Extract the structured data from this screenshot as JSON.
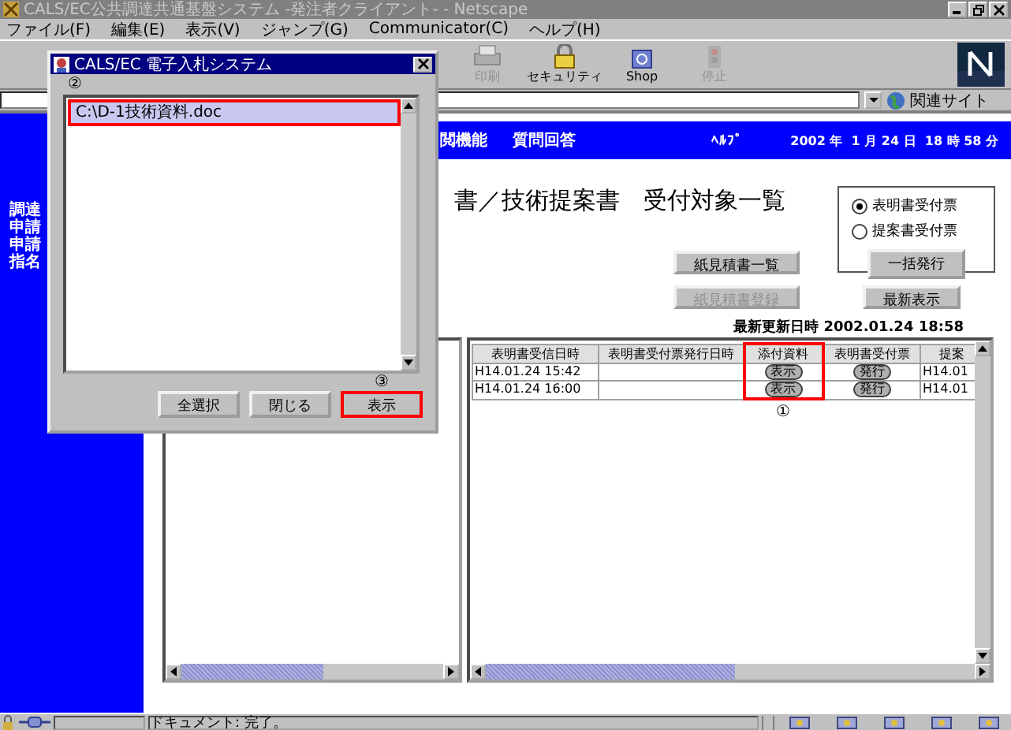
{
  "window": {
    "title": "CALS/EC公共調達共通基盤システム -発注者クライアント- - Netscape"
  },
  "menu": [
    "ファイル(F)",
    "編集(E)",
    "表示(V)",
    "ジャンプ(G)",
    "Communicator(C)",
    "ヘルプ(H)"
  ],
  "toolbar": [
    {
      "label": "印刷",
      "kind": "print",
      "disabled": true
    },
    {
      "label": "セキュリティ",
      "kind": "security",
      "disabled": false
    },
    {
      "label": "Shop",
      "kind": "shop",
      "disabled": false
    },
    {
      "label": "停止",
      "kind": "stop",
      "disabled": true
    }
  ],
  "location_bar": {
    "related_sites": "関連サイト"
  },
  "nav_bar": {
    "items": [
      "閲機能",
      "質問回答"
    ],
    "help": "ﾍﾙﾌﾟ",
    "datetime": "2002 年  1 月 24 日  18 時 58 分"
  },
  "sidebar": {
    "items": [
      "調達",
      "申請",
      "申請",
      "指名"
    ]
  },
  "page": {
    "heading": "書／技術提案書　受付対象一覧",
    "options": [
      {
        "label": "表明書受付票",
        "selected": true
      },
      {
        "label": "提案書受付票",
        "selected": false
      }
    ],
    "batch_button": "一括発行",
    "buttons": [
      {
        "label": "紙見積書一覧",
        "disabled": false
      },
      {
        "label": "紙見積書登録",
        "disabled": true
      },
      {
        "label": "最新表示",
        "disabled": false
      }
    ],
    "last_updated": "最新更新日時 2002.01.24 18:58"
  },
  "table": {
    "columns": [
      {
        "label": "表明書受信日時",
        "highlighted": false
      },
      {
        "label": "表明書受付票発行日時",
        "highlighted": false
      },
      {
        "label": "添付資料",
        "highlighted": true,
        "marker": "①"
      },
      {
        "label": "表明書受付票",
        "highlighted": false
      },
      {
        "label": "提案",
        "highlighted": false
      }
    ],
    "rows": [
      [
        {
          "kind": "text",
          "text": "H14.01.24 15:42"
        },
        {
          "kind": "empty"
        },
        {
          "kind": "button",
          "text": "表示"
        },
        {
          "kind": "button",
          "text": "発行"
        },
        {
          "kind": "text",
          "text": "H14.01"
        }
      ],
      [
        {
          "kind": "text",
          "text": "H14.01.24 16:00"
        },
        {
          "kind": "empty"
        },
        {
          "kind": "button",
          "text": "表示"
        },
        {
          "kind": "button",
          "text": "発行"
        },
        {
          "kind": "text",
          "text": "H14.01"
        }
      ]
    ]
  },
  "dialog": {
    "title": "CALS/EC 電子入札システム",
    "marker": "②",
    "files": [
      {
        "name": "C:\\D-1技術資料.doc",
        "selected": true,
        "highlighted": true
      }
    ],
    "buttons": [
      {
        "label": "全選択",
        "highlighted": false
      },
      {
        "label": "閉じる",
        "highlighted": false
      },
      {
        "label": "表示",
        "highlighted": true,
        "marker": "③"
      }
    ]
  },
  "status_bar": {
    "text": "ドキュメント: 完了。"
  }
}
